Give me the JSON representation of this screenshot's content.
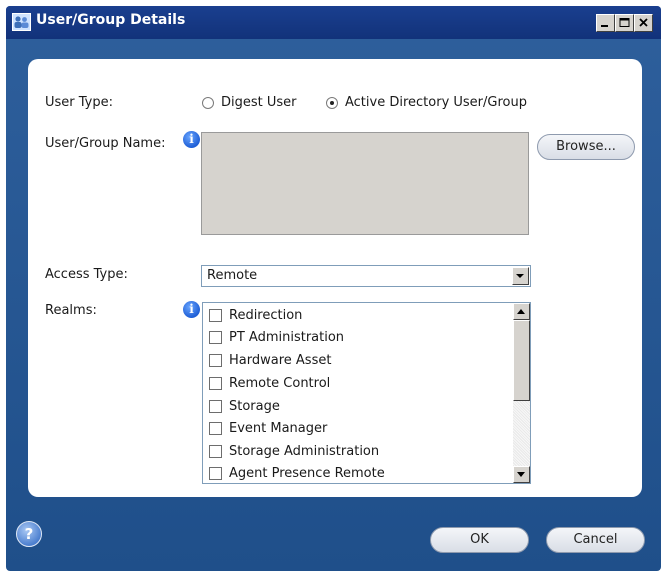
{
  "window": {
    "title": "User/Group Details"
  },
  "form": {
    "user_type_label": "User Type:",
    "user_type_options": [
      "Digest User",
      "Active Directory User/Group"
    ],
    "user_type_selected": "Active Directory User/Group",
    "user_group_name_label": "User/Group Name:",
    "user_group_name_value": "",
    "browse_label": "Browse...",
    "access_type_label": "Access Type:",
    "access_type_value": "Remote",
    "realms_label": "Realms:",
    "realms": [
      {
        "label": "Redirection",
        "checked": false
      },
      {
        "label": "PT Administration",
        "checked": false
      },
      {
        "label": "Hardware Asset",
        "checked": false
      },
      {
        "label": "Remote Control",
        "checked": false
      },
      {
        "label": "Storage",
        "checked": false
      },
      {
        "label": "Event Manager",
        "checked": false
      },
      {
        "label": "Storage Administration",
        "checked": false
      },
      {
        "label": "Agent Presence Remote",
        "checked": false
      }
    ]
  },
  "footer": {
    "ok_label": "OK",
    "cancel_label": "Cancel",
    "help_icon": "help-icon"
  },
  "colors": {
    "window_bg": "#1f4f8a",
    "titlebar_bg": "#12327a",
    "panel_bg": "#ffffff",
    "disabled_field": "#d6d3ce",
    "info_blue": "#1f5fd6"
  }
}
